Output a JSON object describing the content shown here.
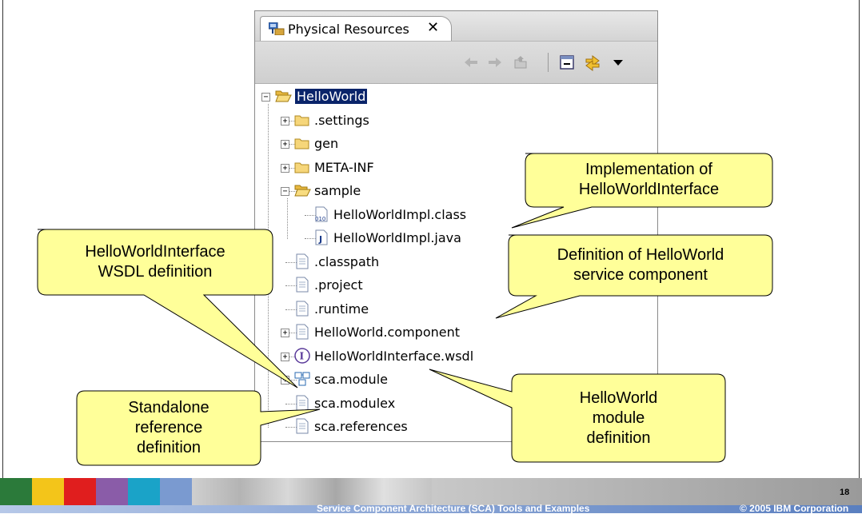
{
  "view": {
    "tab_label": "Physical Resources",
    "tab_close": "✕"
  },
  "toolbar": {
    "icons": [
      "back-arrow-icon",
      "forward-arrow-icon",
      "up-folder-icon",
      "collapse-all-icon",
      "link-with-editor-icon",
      "view-menu-icon"
    ]
  },
  "tree": {
    "items": [
      {
        "label": "HelloWorld",
        "icon": "open-folder-icon",
        "expander": "−",
        "selected": true
      },
      {
        "label": ".settings",
        "icon": "folder-icon",
        "expander": "+"
      },
      {
        "label": "gen",
        "icon": "folder-icon",
        "expander": "+"
      },
      {
        "label": "META-INF",
        "icon": "folder-icon",
        "expander": "+"
      },
      {
        "label": "sample",
        "icon": "open-folder-icon",
        "expander": "−"
      },
      {
        "label": "HelloWorldImpl.class",
        "icon": "class-file-icon",
        "expander": ""
      },
      {
        "label": "HelloWorldImpl.java",
        "icon": "java-file-icon",
        "expander": ""
      },
      {
        "label": ".classpath",
        "icon": "file-icon",
        "expander": ""
      },
      {
        "label": ".project",
        "icon": "file-icon",
        "expander": ""
      },
      {
        "label": ".runtime",
        "icon": "file-icon",
        "expander": ""
      },
      {
        "label": "HelloWorld.component",
        "icon": "file-icon",
        "expander": "+"
      },
      {
        "label": "HelloWorldInterface.wsdl",
        "icon": "interface-icon",
        "expander": "+"
      },
      {
        "label": "sca.module",
        "icon": "module-icon",
        "expander": "+"
      },
      {
        "label": "sca.modulex",
        "icon": "file-icon",
        "expander": ""
      },
      {
        "label": "sca.references",
        "icon": "file-icon",
        "expander": ""
      }
    ]
  },
  "callouts": {
    "implementation": [
      "Implementation of",
      "HelloWorldInterface"
    ],
    "interface_wsdl": [
      "HelloWorldInterface",
      "WSDL definition"
    ],
    "component_def": [
      "Definition of HelloWorld",
      "service component"
    ],
    "module_def": [
      "HelloWorld",
      "module",
      "definition"
    ],
    "standalone_ref": [
      "Standalone",
      "reference",
      "definition"
    ]
  },
  "footer": {
    "title": "Service Component Architecture (SCA) Tools and Examples",
    "copyright": "© 2005 IBM Corporation",
    "page_number": "18"
  },
  "colors": {
    "callout_fill": "#ffff99",
    "selection": "#0a246a"
  }
}
